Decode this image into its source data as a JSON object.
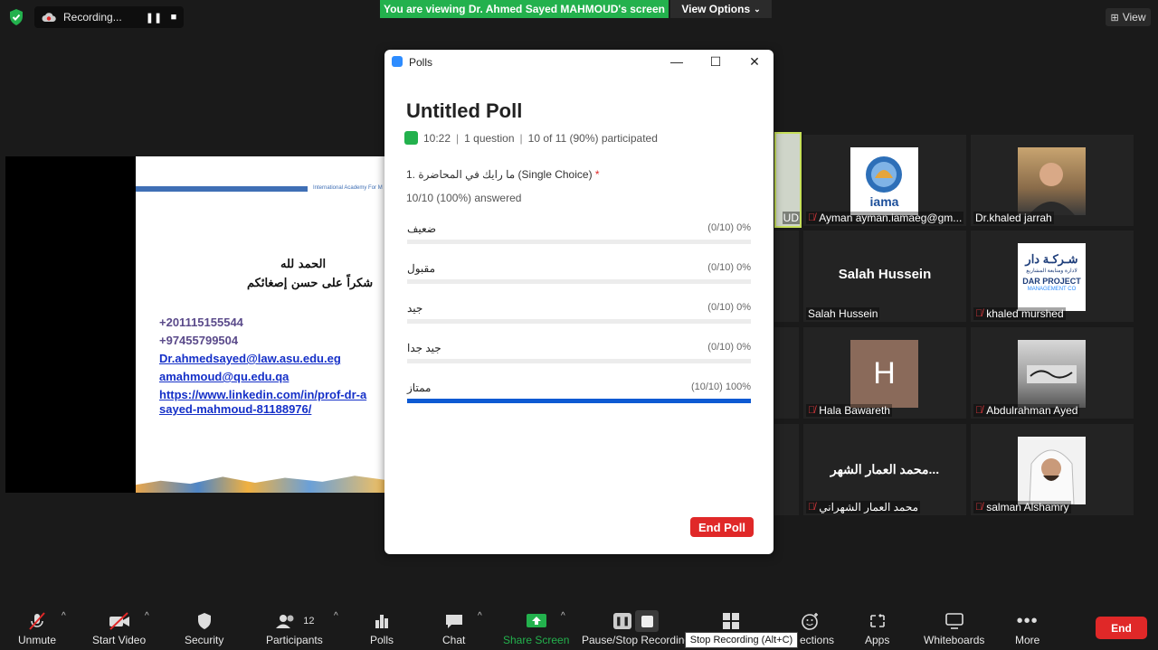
{
  "top": {
    "recording_label": "Recording...",
    "banner": "You are viewing Dr. Ahmed Sayed MAHMOUD's screen",
    "view_options": "View Options",
    "view": "View"
  },
  "slide": {
    "academy": "International Academy For M",
    "line1": "الحمد لله",
    "line2": "شكراً على حسن إصغائكم",
    "phone1": "+201115155544",
    "phone2": "+97455799504",
    "email1": "Dr.ahmedsayed@law.asu.edu.eg",
    "email2": "amahmoud@qu.edu.qa",
    "linkedin1": "https://www.linkedin.com/in/prof-dr-a",
    "linkedin2": "sayed-mahmoud-81188976/"
  },
  "tiles": {
    "speaker_partial": "UD",
    "t1": "Ayman ayman.iamaeg@gm...",
    "t2": "Dr.khaled jarrah",
    "t3_big": "Salah Hussein",
    "t3": "Salah Hussein",
    "t4": "khaled murshed",
    "t5_initial": "H",
    "t5": "Hala Bawareth",
    "t6": "Abdulrahman Ayed",
    "t7_big": "محمد العمار الشهر...",
    "t7": "محمد العمار الشهراني",
    "t8": "salman Alshamry",
    "logo_iama": "iama",
    "logo_dar_ar": "شـركـة دار",
    "logo_dar_sub": "لادارة ومتابعة المشاريع",
    "logo_dar_en": "DAR PROJECT",
    "logo_dar_en2": "MANAGEMENT CO"
  },
  "polls": {
    "window_title": "Polls",
    "title": "Untitled Poll",
    "time": "10:22",
    "questions": "1 question",
    "participated": "10 of 11 (90%) participated",
    "question": "1. ما رايك في المحاضرة (Single Choice)",
    "required_mark": "*",
    "answered": "10/10 (100%) answered",
    "options": [
      {
        "label": "ضعيف",
        "result": "(0/10) 0%",
        "fraction": 0
      },
      {
        "label": "مقبول",
        "result": "(0/10) 0%",
        "fraction": 0
      },
      {
        "label": "جيد",
        "result": "(0/10) 0%",
        "fraction": 0
      },
      {
        "label": "جيد جدا",
        "result": "(0/10) 0%",
        "fraction": 0
      },
      {
        "label": "ممتاز",
        "result": "(10/10) 100%",
        "fraction": 1
      }
    ],
    "end_poll": "End Poll"
  },
  "toolbar": {
    "unmute": "Unmute",
    "start_video": "Start Video",
    "security": "Security",
    "participants": "Participants",
    "participants_count": "12",
    "polls": "Polls",
    "chat": "Chat",
    "share_screen": "Share Screen",
    "pause_stop": "Pause/Stop Recording",
    "tooltip": "Stop Recording (Alt+C)",
    "reactions_partial": "ections",
    "apps": "Apps",
    "whiteboards": "Whiteboards",
    "more": "More",
    "end": "End"
  },
  "colors": {
    "banner_green": "#23b14d",
    "poll_fill": "#0e5ad3",
    "end_red": "#e02828",
    "speaker_border": "#c7e05a"
  }
}
